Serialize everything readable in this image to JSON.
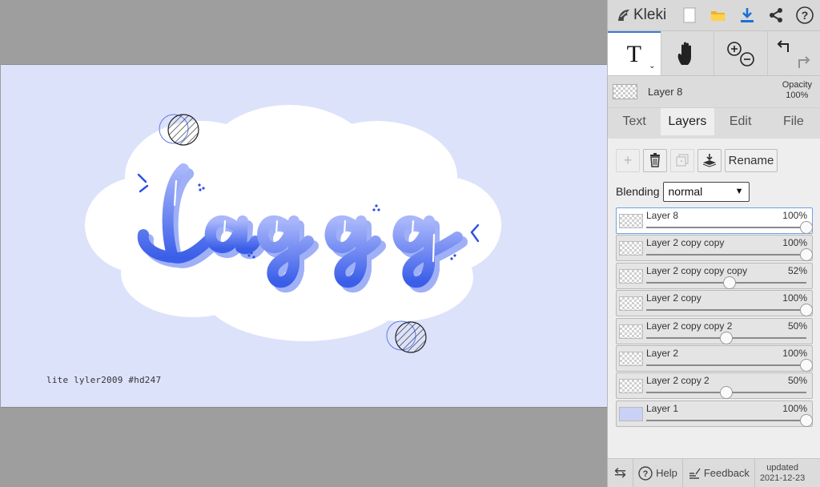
{
  "app": {
    "name": "Kleki",
    "accent": "#3b7bd9"
  },
  "topbar": {
    "icons": [
      "new-image-icon",
      "open-folder-icon",
      "download-icon",
      "share-icon",
      "help-icon"
    ]
  },
  "tools": {
    "items": [
      "text-tool-icon",
      "hand-tool-icon",
      "zoom-icons",
      "undo-redo-icons"
    ]
  },
  "current_layer": {
    "name": "Layer 8",
    "opacity_label": "Opacity",
    "opacity_value": "100%"
  },
  "tabs": [
    {
      "label": "Text"
    },
    {
      "label": "Layers"
    },
    {
      "label": "Edit"
    },
    {
      "label": "File"
    }
  ],
  "layer_buttons": {
    "rename_label": "Rename"
  },
  "blending": {
    "label": "Blending",
    "value": "normal"
  },
  "layers": [
    {
      "name": "Layer 8",
      "opacity": "100%",
      "level": 1.0
    },
    {
      "name": "Layer 2 copy copy",
      "opacity": "100%",
      "level": 1.0
    },
    {
      "name": "Layer 2 copy copy copy",
      "opacity": "52%",
      "level": 0.52
    },
    {
      "name": "Layer 2 copy",
      "opacity": "100%",
      "level": 1.0
    },
    {
      "name": "Layer 2 copy copy 2",
      "opacity": "50%",
      "level": 0.5
    },
    {
      "name": "Layer 2",
      "opacity": "100%",
      "level": 1.0
    },
    {
      "name": "Layer 2 copy 2",
      "opacity": "50%",
      "level": 0.5
    },
    {
      "name": "Layer 1",
      "opacity": "100%",
      "level": 1.0
    }
  ],
  "bottombar": {
    "help_label": "Help",
    "feedback_label": "Feedback",
    "updated_label": "updated",
    "updated_date": "2021-12-23"
  },
  "artwork": {
    "lettering": "Laggg",
    "signature": "lite  lyler2009  #hd247",
    "background_color": "#dde2fb",
    "cloud_color": "#ffffff",
    "letter_color": "#4c6ff0"
  }
}
